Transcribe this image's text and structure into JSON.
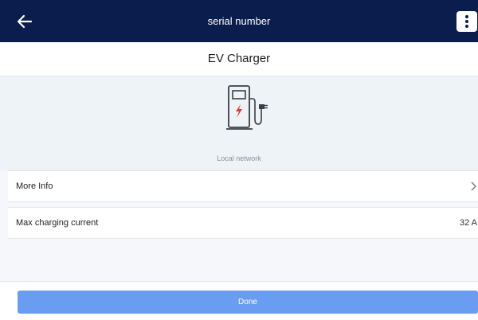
{
  "topbar": {
    "title": "serial number",
    "back_icon": "arrow-left-icon",
    "menu_icon": "more-vertical-icon"
  },
  "header": {
    "title": "EV Charger"
  },
  "device": {
    "icon": "ev-charger-icon",
    "connection": "Local network",
    "accent_color": "#e53935"
  },
  "rows": {
    "more_info": {
      "label": "More Info",
      "icon": "chevron-right-icon"
    },
    "max_current": {
      "label": "Max charging current",
      "value": "32 A"
    }
  },
  "footer": {
    "done_label": "Done",
    "button_color": "#6a9df2"
  },
  "theme": {
    "topbar_color": "#0b1d4d"
  }
}
